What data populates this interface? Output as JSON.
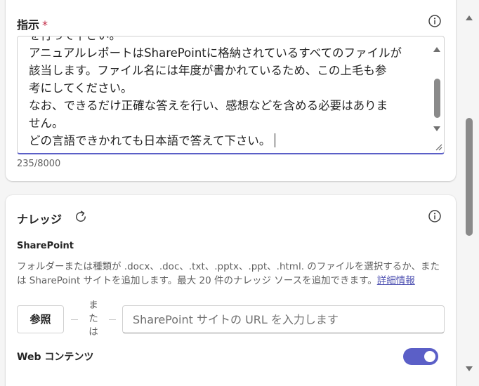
{
  "instructions": {
    "title": "指示",
    "required_mark": "*",
    "lines": [
      "を行って下さい。",
      "アニュアルレポートはSharePointに格納されているすべてのファイルが",
      "該当します。ファイル名には年度が書かれているため、この上毛も参",
      "考にしてください。",
      "なお、できるだけ正確な答えを行い、感想などを含める必要はありま",
      "せん。",
      "どの言語できかれても日本語で答えて下さい。"
    ],
    "counter": "235/8000"
  },
  "knowledge": {
    "title": "ナレッジ",
    "sharepoint": {
      "title": "SharePoint",
      "description": "フォルダーまたは種類が .docx、.doc、.txt、.pptx、.ppt、.html. のファイルを選択するか、または SharePoint サイトを追加します。最大 20 件のナレッジ ソースを追加できます。",
      "link": "詳細情報",
      "browse_label": "参照",
      "or_label": "または",
      "url_placeholder": "SharePoint サイトの URL を入力します"
    },
    "web_content": {
      "label": "Web コンテンツ",
      "enabled": true
    }
  },
  "colors": {
    "accent": "#5b5fc7",
    "required": "#c4314b",
    "link": "#4f52b2"
  },
  "icons": [
    "info-icon",
    "refresh-icon",
    "chevron-up-icon",
    "chevron-down-icon",
    "resize-grip-icon"
  ]
}
